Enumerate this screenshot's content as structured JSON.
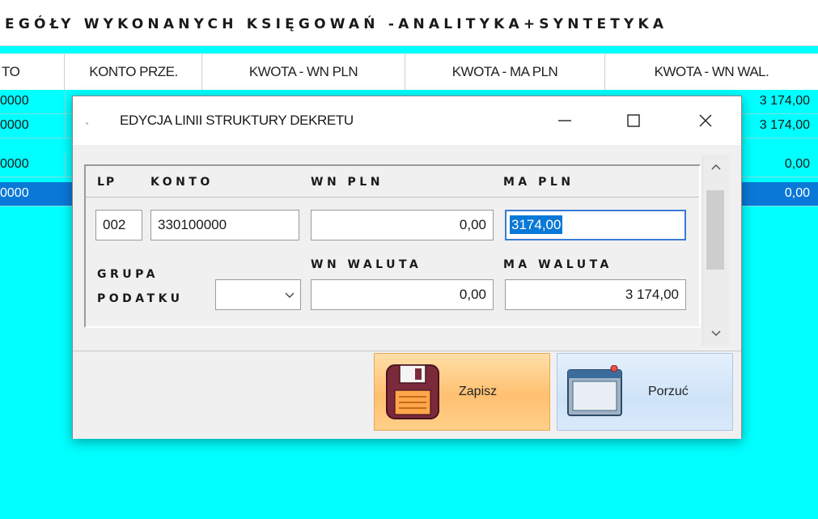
{
  "background": {
    "title": "EGÓŁY WYKONANYCH KSIĘGOWAŃ -ANALITYKA+SYNTETYKA",
    "columns": [
      "TO",
      "KONTO PRZE.",
      "KWOTA - WN PLN",
      "KWOTA - MA PLN",
      "KWOTA - WN WAL."
    ],
    "rows": [
      {
        "left": "0000",
        "right": "3 174,00",
        "selected": false
      },
      {
        "left": "0000",
        "right": "3 174,00",
        "selected": false
      },
      {
        "left": "0000",
        "right": "0,00",
        "selected": false
      },
      {
        "left": "0000",
        "right": "0,00",
        "selected": true
      }
    ]
  },
  "dialog": {
    "title": "EDYCJA LINII STRUKTURY DEKRETU",
    "labels": {
      "lp": "LP",
      "konto": "KONTO",
      "wn_pln": "WN PLN",
      "ma_pln": "MA PLN",
      "grupa": "GRUPA",
      "podatku": "PODATKU",
      "wn_waluta": "WN WALUTA",
      "ma_waluta": "MA WALUTA"
    },
    "fields": {
      "lp": "002",
      "konto": "330100000",
      "wn_pln": "0,00",
      "ma_pln": "3174,00",
      "wn_waluta": "0,00",
      "ma_waluta": "3 174,00",
      "grupa_podatku": ""
    },
    "buttons": {
      "save": "Zapisz",
      "cancel": "Porzuć"
    }
  },
  "colors": {
    "background": "#00ffff",
    "selection": "#0a78d7",
    "save_button": "#ffc070",
    "cancel_button": "#cfe3f8"
  },
  "icons": [
    "minimize-icon",
    "maximize-icon",
    "close-icon",
    "chevron-down-icon",
    "scroll-up-icon",
    "scroll-down-icon",
    "floppy-disk-icon",
    "window-icon"
  ]
}
